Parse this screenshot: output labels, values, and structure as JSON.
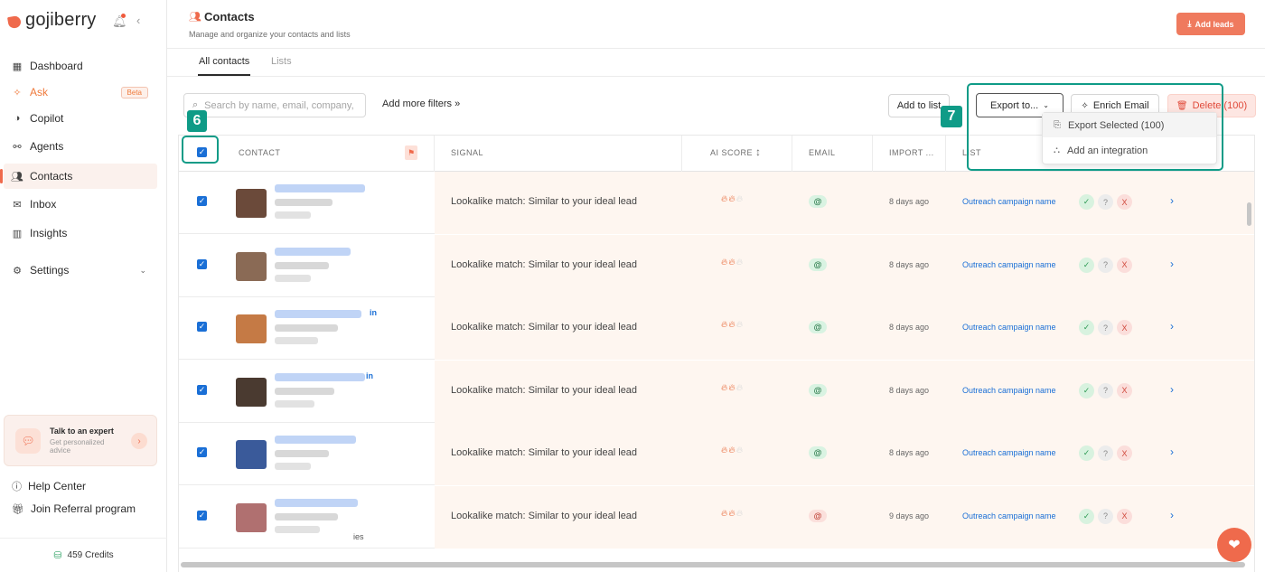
{
  "app": {
    "logo": "gojiberry"
  },
  "sidebar": {
    "items": [
      {
        "label": "Dashboard",
        "icon": "dashboard-icon"
      },
      {
        "label": "Ask",
        "icon": "sparkle-icon",
        "badge": "Beta"
      },
      {
        "label": "Copilot",
        "icon": "copilot-icon"
      },
      {
        "label": "Agents",
        "icon": "agents-icon"
      },
      {
        "label": "Contacts",
        "icon": "contacts-icon",
        "active": true
      },
      {
        "label": "Inbox",
        "icon": "inbox-icon"
      },
      {
        "label": "Insights",
        "icon": "insights-icon"
      },
      {
        "label": "Settings",
        "icon": "settings-icon"
      }
    ],
    "expert": {
      "title": "Talk to an expert",
      "subtitle": "Get personalized advice"
    },
    "help": "Help Center",
    "referral": "Join Referral program",
    "credits": "459 Credits"
  },
  "header": {
    "title": "Contacts",
    "subtitle": "Manage and organize your contacts and lists",
    "add_leads": "Add leads"
  },
  "tabs": [
    "All contacts",
    "Lists"
  ],
  "toolbar": {
    "search_placeholder": "Search by name, email, company,",
    "more_filters": "Add more filters »",
    "add_to_list": "Add to list",
    "export": "Export to...",
    "enrich": "Enrich Email",
    "delete": "Delete (100)"
  },
  "export_menu": {
    "items": [
      "Export Selected (100)",
      "Add an integration"
    ]
  },
  "callouts": {
    "left": "6",
    "right": "7"
  },
  "table": {
    "columns": [
      "CONTACT",
      "SIGNAL",
      "AI SCORE",
      "EMAIL",
      "IMPORT ...",
      "LIST"
    ],
    "rows": [
      {
        "signal": "Lookalike match: Similar to your ideal lead",
        "imported": "8 days ago",
        "list": "Outreach campaign name",
        "email_status": "ok",
        "linkedin": "",
        "extra": ""
      },
      {
        "signal": "Lookalike match: Similar to your ideal lead",
        "imported": "8 days ago",
        "list": "Outreach campaign name",
        "email_status": "ok",
        "linkedin": "",
        "extra": ""
      },
      {
        "signal": "Lookalike match: Similar to your ideal lead",
        "imported": "8 days ago",
        "list": "Outreach campaign name",
        "email_status": "ok",
        "linkedin": "in",
        "extra": ""
      },
      {
        "signal": "Lookalike match: Similar to your ideal lead",
        "imported": "8 days ago",
        "list": "Outreach campaign name",
        "email_status": "ok",
        "linkedin": "in",
        "extra": ""
      },
      {
        "signal": "Lookalike match: Similar to your ideal lead",
        "imported": "8 days ago",
        "list": "Outreach campaign name",
        "email_status": "ok",
        "linkedin": "",
        "extra": ""
      },
      {
        "signal": "Lookalike match: Similar to your ideal lead",
        "imported": "9 days ago",
        "list": "Outreach campaign name",
        "email_status": "warn",
        "linkedin": "",
        "extra": "ies"
      }
    ],
    "ai_score": "2 of 3"
  },
  "colors": {
    "accent": "#ef6a4c",
    "callout": "#0f9b87",
    "link": "#1a6fd6"
  }
}
